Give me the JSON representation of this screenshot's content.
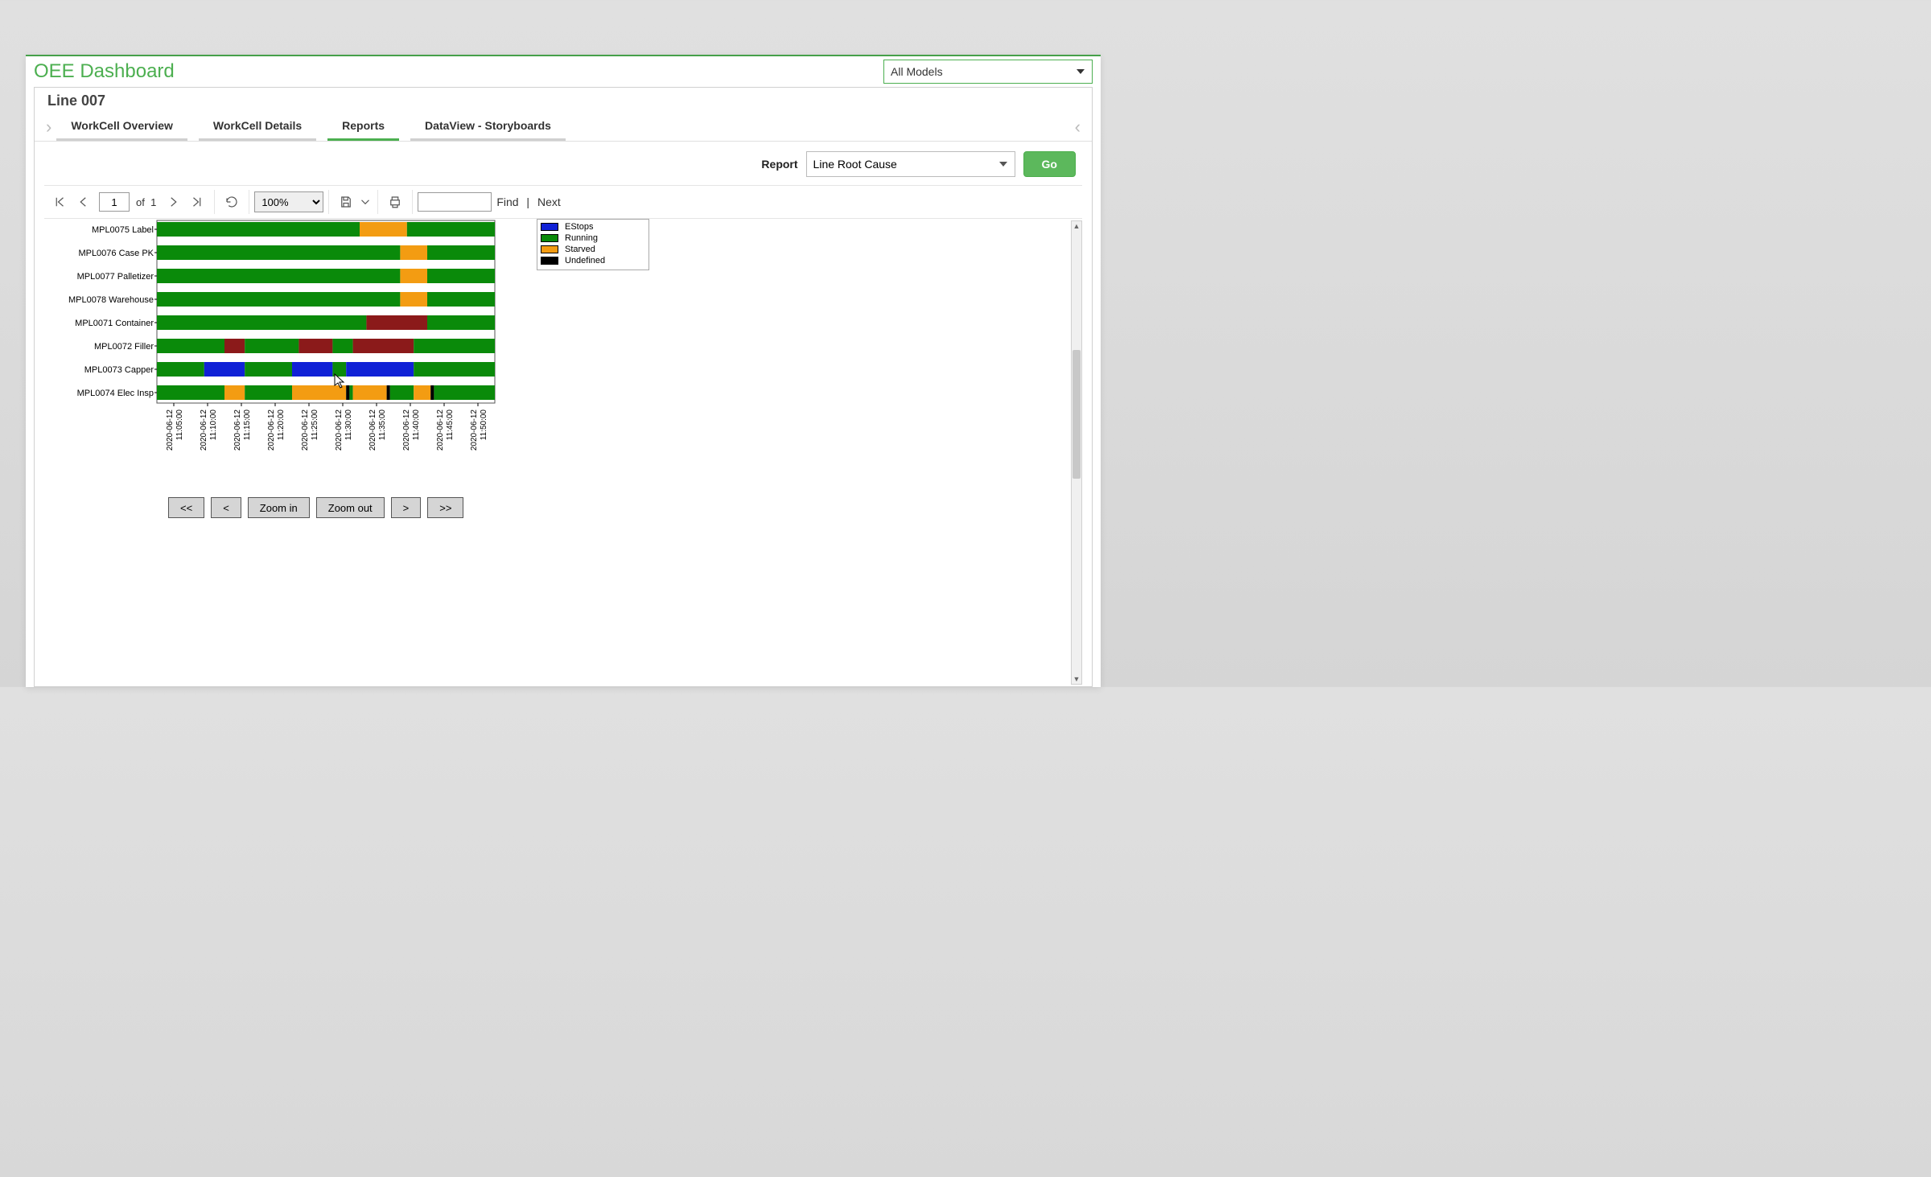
{
  "header": {
    "title": "OEE Dashboard",
    "models_selected": "All Models"
  },
  "line": {
    "title": "Line 007"
  },
  "tabs": [
    {
      "label": "WorkCell Overview",
      "active": false
    },
    {
      "label": "WorkCell Details",
      "active": false
    },
    {
      "label": "Reports",
      "active": true
    },
    {
      "label": "DataView - Storyboards",
      "active": false
    }
  ],
  "report": {
    "label": "Report",
    "selected": "Line Root Cause",
    "go_label": "Go"
  },
  "toolbar": {
    "page_value": "1",
    "page_of": "of",
    "page_total": "1",
    "zoom": "100%",
    "find_label": "Find",
    "next_label": "Next"
  },
  "legend": [
    {
      "label": "EStops",
      "color": "#1021d6"
    },
    {
      "label": "Running",
      "color": "#0a8a0a"
    },
    {
      "label": "Starved",
      "color": "#f39c12"
    },
    {
      "label": "Undefined",
      "color": "#000000"
    }
  ],
  "nav_buttons": {
    "first": "<<",
    "prev": "<",
    "zoom_in": "Zoom in",
    "zoom_out": "Zoom out",
    "next": ">",
    "last": ">>"
  },
  "chart_data": {
    "type": "gantt",
    "x_axis_ticks": [
      "2020-06-12 11:05:00",
      "2020-06-12 11:10:00",
      "2020-06-12 11:15:00",
      "2020-06-12 11:20:00",
      "2020-06-12 11:25:00",
      "2020-06-12 11:30:00",
      "2020-06-12 11:35:00",
      "2020-06-12 11:40:00",
      "2020-06-12 11:45:00",
      "2020-06-12 11:50:00"
    ],
    "x_range": [
      0,
      50
    ],
    "states": {
      "Running": "#0a8a0a",
      "EStops": "#1021d6",
      "Starved": "#f39c12",
      "Undefined": "#000000",
      "Fault": "#8b1a1a"
    },
    "rows": [
      {
        "name": "MPL0075 Label",
        "segments": [
          {
            "state": "Running",
            "start": 0,
            "end": 30
          },
          {
            "state": "Starved",
            "start": 30,
            "end": 37
          },
          {
            "state": "Running",
            "start": 37,
            "end": 50
          }
        ]
      },
      {
        "name": "MPL0076 Case PK",
        "segments": [
          {
            "state": "Running",
            "start": 0,
            "end": 36
          },
          {
            "state": "Starved",
            "start": 36,
            "end": 40
          },
          {
            "state": "Running",
            "start": 40,
            "end": 50
          }
        ]
      },
      {
        "name": "MPL0077 Palletizer",
        "segments": [
          {
            "state": "Running",
            "start": 0,
            "end": 36
          },
          {
            "state": "Starved",
            "start": 36,
            "end": 40
          },
          {
            "state": "Running",
            "start": 40,
            "end": 50
          }
        ]
      },
      {
        "name": "MPL0078 Warehouse",
        "segments": [
          {
            "state": "Running",
            "start": 0,
            "end": 36
          },
          {
            "state": "Starved",
            "start": 36,
            "end": 40
          },
          {
            "state": "Running",
            "start": 40,
            "end": 50
          }
        ]
      },
      {
        "name": "MPL0071 Container",
        "segments": [
          {
            "state": "Running",
            "start": 0,
            "end": 31
          },
          {
            "state": "Fault",
            "start": 31,
            "end": 40
          },
          {
            "state": "Running",
            "start": 40,
            "end": 50
          }
        ]
      },
      {
        "name": "MPL0072 Filler",
        "segments": [
          {
            "state": "Running",
            "start": 0,
            "end": 10
          },
          {
            "state": "Fault",
            "start": 10,
            "end": 13
          },
          {
            "state": "Running",
            "start": 13,
            "end": 21
          },
          {
            "state": "Fault",
            "start": 21,
            "end": 26
          },
          {
            "state": "Running",
            "start": 26,
            "end": 29
          },
          {
            "state": "Fault",
            "start": 29,
            "end": 38
          },
          {
            "state": "Running",
            "start": 38,
            "end": 50
          }
        ]
      },
      {
        "name": "MPL0073 Capper",
        "segments": [
          {
            "state": "Running",
            "start": 0,
            "end": 7
          },
          {
            "state": "EStops",
            "start": 7,
            "end": 13
          },
          {
            "state": "Running",
            "start": 13,
            "end": 20
          },
          {
            "state": "EStops",
            "start": 20,
            "end": 26
          },
          {
            "state": "Running",
            "start": 26,
            "end": 28
          },
          {
            "state": "EStops",
            "start": 28,
            "end": 38
          },
          {
            "state": "Running",
            "start": 38,
            "end": 50
          }
        ]
      },
      {
        "name": "MPL0074 Elec Insp",
        "segments": [
          {
            "state": "Running",
            "start": 0,
            "end": 10
          },
          {
            "state": "Starved",
            "start": 10,
            "end": 13
          },
          {
            "state": "Running",
            "start": 13,
            "end": 20
          },
          {
            "state": "Starved",
            "start": 20,
            "end": 28
          },
          {
            "state": "Undefined",
            "start": 28,
            "end": 28.5
          },
          {
            "state": "Running",
            "start": 28.5,
            "end": 29
          },
          {
            "state": "Starved",
            "start": 29,
            "end": 34
          },
          {
            "state": "Undefined",
            "start": 34,
            "end": 34.5
          },
          {
            "state": "Running",
            "start": 34.5,
            "end": 38
          },
          {
            "state": "Starved",
            "start": 38,
            "end": 40.5
          },
          {
            "state": "Undefined",
            "start": 40.5,
            "end": 41
          },
          {
            "state": "Running",
            "start": 41,
            "end": 50
          }
        ]
      }
    ]
  }
}
